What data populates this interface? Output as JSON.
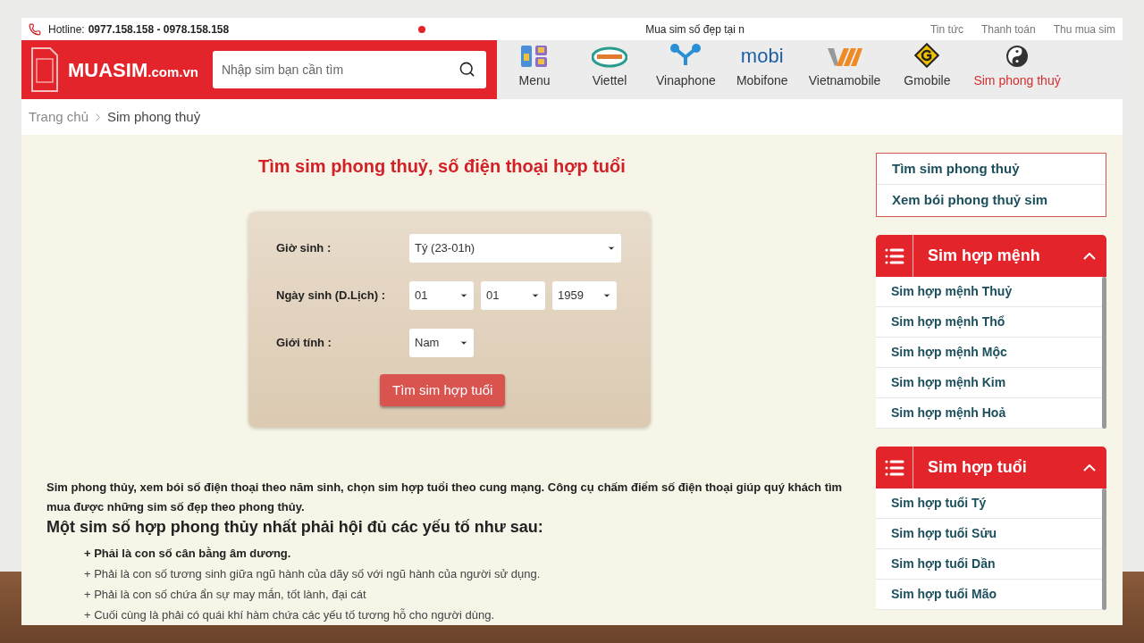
{
  "top_bar": {
    "hotline_label": "Hotline:",
    "hotline_numbers": "0977.158.158 - 0978.158.158",
    "marquee": "Mua sim số đẹp tại n",
    "links": [
      "Tin tức",
      "Thanh toán",
      "Thu mua sim"
    ]
  },
  "header": {
    "logo": "MUASIM",
    "logo_suffix": ".com.vn",
    "search": {
      "placeholder": "Nhập sim bạn cần tìm"
    },
    "nav": [
      {
        "kind": "menu",
        "label": "Menu",
        "selected": false
      },
      {
        "kind": "viettel",
        "label": "Viettel",
        "selected": false
      },
      {
        "kind": "vinaphone",
        "label": "Vinaphone",
        "selected": false
      },
      {
        "kind": "mobifone",
        "label": "Mobifone",
        "selected": false,
        "logo_text": "mobi"
      },
      {
        "kind": "vietnamobile",
        "label": "Vietnamobile",
        "selected": false
      },
      {
        "kind": "gmobile",
        "label": "Gmobile",
        "selected": false
      },
      {
        "kind": "fengshui",
        "label": "Sim phong thuỷ",
        "selected": true
      }
    ]
  },
  "breadcrumb": [
    "Trang chủ",
    "Sim phong thuỷ"
  ],
  "main": {
    "title": "Tìm sim phong thuỷ, số điện thoại hợp tuổi",
    "form": {
      "fields": [
        {
          "label": "Giờ sinh :",
          "selects": [
            "Tý (23-01h)"
          ]
        },
        {
          "label": "Ngày sinh (D.Lịch) :",
          "selects": [
            "01",
            "01",
            "1959"
          ]
        },
        {
          "label": "Giới tính :",
          "selects": [
            "Nam"
          ]
        }
      ],
      "button": "Tìm sim hợp tuổi"
    },
    "intro": "Sim phong thủy, xem bói số điện thoại theo năm sinh, chọn sim hợp tuổi theo cung mạng. Công cụ chấm điểm số điện thoại giúp quý khách tìm mua được những sim số đẹp theo phong thủy.",
    "heading": "Một sim số hợp phong thủy nhất phải hội đủ các yếu tố như sau:",
    "points": [
      {
        "text": "+ Phải là con số cân bằng âm dương.",
        "bold": true
      },
      {
        "text": "+ Phải là con số tương sinh giữa ngũ hành của dãy số với ngũ hành của người sử dụng.",
        "bold": false
      },
      {
        "text": "+ Phải là con số chứa ẩn sự may mắn, tốt lành, đại cát",
        "bold": false
      },
      {
        "text": "+ Cuối cùng là phải có quái khí hàm chứa các yếu tố tương hỗ cho người dùng.",
        "bold": false
      }
    ]
  },
  "sidebar": {
    "links": [
      "Tìm sim phong thuỷ",
      "Xem bói phong thuỷ sim"
    ],
    "panels": [
      {
        "title": "Sim hợp mệnh",
        "expanded": true,
        "items": [
          "Sim hợp mệnh Thuỷ",
          "Sim hợp mệnh Thổ",
          "Sim hợp mệnh Mộc",
          "Sim hợp mệnh Kim",
          "Sim hợp mệnh Hoả"
        ]
      },
      {
        "title": "Sim hợp tuổi",
        "expanded": true,
        "items": [
          "Sim hợp tuổi Tý",
          "Sim hợp tuổi Sửu",
          "Sim hợp tuổi Dần",
          "Sim hợp tuổi Mão"
        ]
      }
    ]
  }
}
